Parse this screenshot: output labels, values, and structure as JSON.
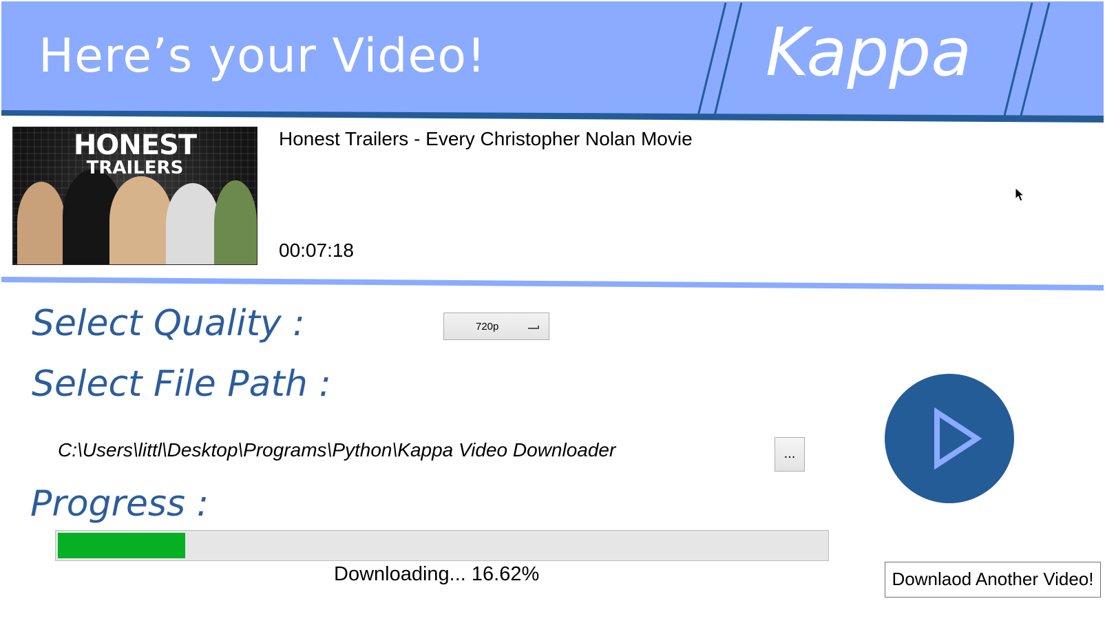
{
  "header": {
    "title": "Here’s your Video!",
    "brand": "Kappa"
  },
  "video": {
    "thumbnail_title": "HONEST",
    "thumbnail_subtitle": "TRAILERS",
    "title": "Honest Trailers - Every Christopher Nolan Movie",
    "duration": "00:07:18"
  },
  "quality": {
    "label": "Select Quality :",
    "selected": "720p",
    "icon": "chevron-down-icon"
  },
  "file_path": {
    "label": "Select File Path :",
    "value": "C:\\Users\\littl\\Desktop\\Programs\\Python\\Kappa Video Downloader",
    "browse_label": "..."
  },
  "progress": {
    "label": "Progress :",
    "status_text": "Downloading... 16.62%",
    "fraction": 0.1662
  },
  "actions": {
    "play_icon": "play-icon",
    "another_label": "Downlaod Another Video!"
  },
  "colors": {
    "header_bg": "#8aabff",
    "header_dark": "#245c97",
    "label_text": "#2b5d9e",
    "progress_fill": "#06b025",
    "play_button": "#245c97"
  }
}
